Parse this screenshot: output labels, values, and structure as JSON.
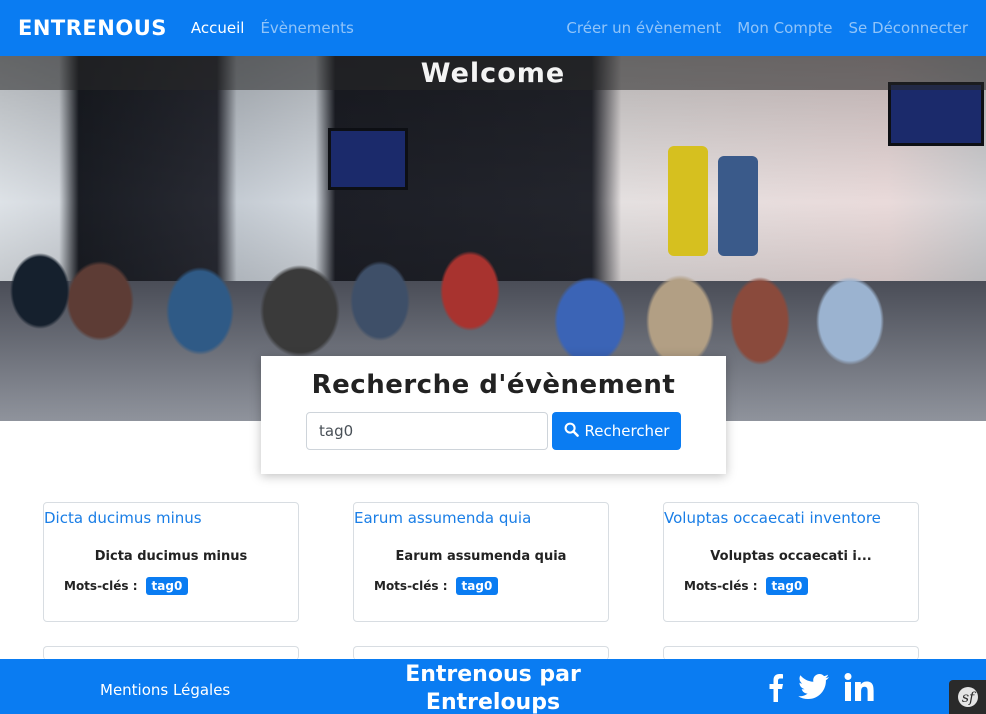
{
  "navbar": {
    "brand": "ENTRENOUS",
    "left_links": [
      {
        "label": "Accueil",
        "active": true
      },
      {
        "label": "Évènements",
        "active": false
      }
    ],
    "right_links": [
      {
        "label": "Créer un évènement"
      },
      {
        "label": "Mon Compte"
      },
      {
        "label": "Se Déconnecter"
      }
    ]
  },
  "hero": {
    "welcome": "Welcome"
  },
  "search": {
    "title": "Recherche d'évènement",
    "input_value": "tag0",
    "button_label": "Rechercher",
    "button_icon": "search-icon"
  },
  "events": [
    {
      "title": "Dicta ducimus minus",
      "body": "Dicta ducimus minus",
      "tags_label": "Mots-clés :",
      "tag": "tag0"
    },
    {
      "title": "Earum assumenda quia",
      "body": "Earum assumenda quia",
      "tags_label": "Mots-clés :",
      "tag": "tag0"
    },
    {
      "title": "Voluptas occaecati inventore",
      "body": "Voluptas occaecati i...",
      "tags_label": "Mots-clés :",
      "tag": "tag0"
    }
  ],
  "footer": {
    "legal": "Mentions Légales",
    "credit_line1": "Entrenous par",
    "credit_line2": "Entreloups",
    "social_icons": [
      "facebook-icon",
      "twitter-icon",
      "linkedin-icon"
    ]
  },
  "colors": {
    "primary": "#0a7cf2",
    "link": "#1a7ee6"
  }
}
